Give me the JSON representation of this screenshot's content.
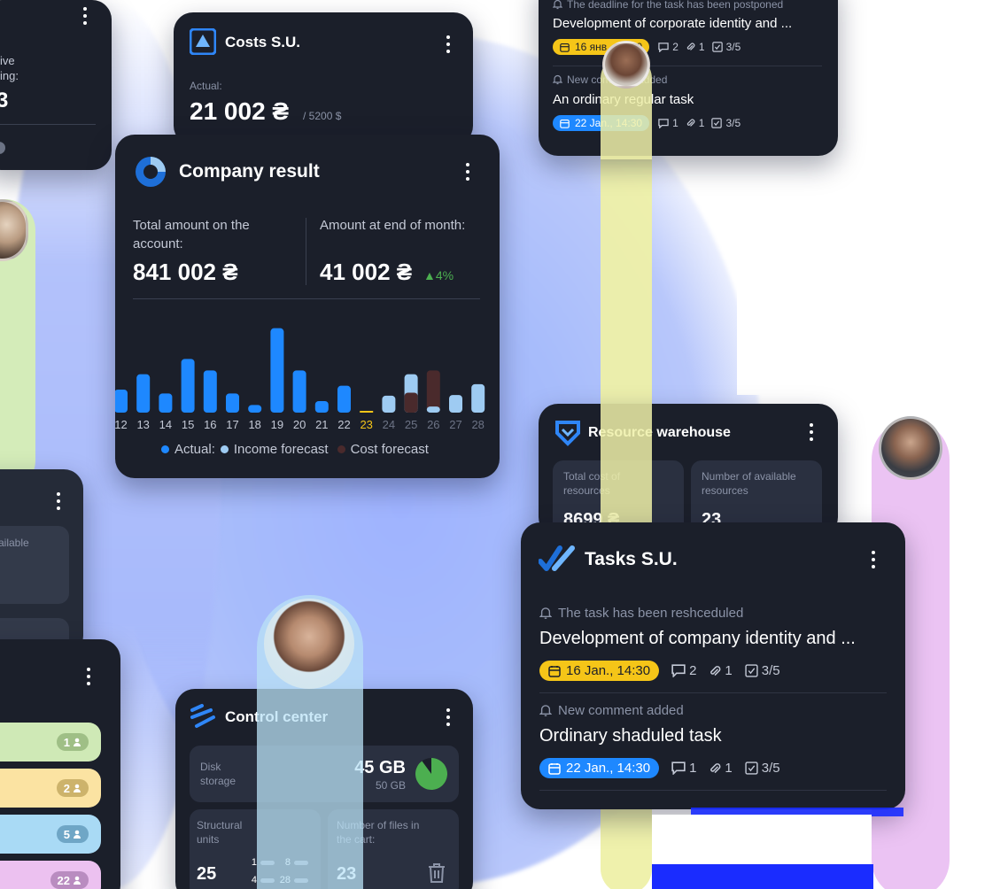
{
  "colors": {
    "accent_blue": "#1e88ff",
    "forecast_blue": "#9ecbf2",
    "cost_brown": "#4a2a2c",
    "highlight_yellow": "#f5c518",
    "growth_green": "#4caf50"
  },
  "costs_card": {
    "title": "Costs S.U.",
    "actual_label": "Actual:",
    "amount": "21 002 ₴",
    "limit": "/ 5200 $"
  },
  "left_top_card": {
    "text_line1": "ive",
    "text_line2": "ing:",
    "value": "3"
  },
  "company_card": {
    "title": "Company result",
    "total_label": "Total amount on the account:",
    "total_value": "841 002 ₴",
    "end_label": "Amount at end of month:",
    "end_value": "41 002 ₴",
    "growth": "▲4%",
    "legend": {
      "actual": "Actual:",
      "income": "Income forecast",
      "cost": "Cost forecast"
    }
  },
  "chart_data": {
    "type": "bar",
    "categories": [
      "12",
      "13",
      "14",
      "15",
      "16",
      "17",
      "18",
      "19",
      "20",
      "21",
      "22",
      "23",
      "24",
      "25",
      "26",
      "27",
      "28"
    ],
    "series": [
      {
        "name": "Actual",
        "values": [
          3,
          5,
          2.5,
          7,
          5.5,
          2.5,
          1,
          11,
          5.5,
          1.5,
          3.5,
          0,
          0,
          0,
          0,
          0,
          0
        ]
      },
      {
        "name": "Income forecast",
        "values": [
          0,
          0,
          0,
          0,
          0,
          0,
          0,
          0,
          0,
          0,
          0,
          0,
          2.2,
          5,
          0.8,
          2.3,
          3.7
        ]
      },
      {
        "name": "Cost forecast",
        "values": [
          0,
          0,
          0,
          0,
          0,
          0,
          0,
          0,
          0,
          0,
          0,
          0,
          0,
          2.6,
          5.5,
          0,
          0
        ]
      }
    ],
    "highlight_category": "23",
    "ylim": [
      0,
      12
    ],
    "legend_position": "bottom"
  },
  "top_tasks_card": {
    "row1_notice": "The deadline for the task has been postponed",
    "row1_title": "Development of corporate identity and ...",
    "row1_date": "16 янв., 14:30",
    "row1_comments": "2",
    "row1_attachments": "1",
    "row1_checklist": "3/5",
    "row2_notice": "New comment added",
    "row2_title": "An ordinary regular task",
    "row2_date": "22 Jan., 14:30",
    "row2_comments": "1",
    "row2_attachments": "1",
    "row2_checklist": "3/5"
  },
  "resource_card": {
    "title": "Resource warehouse",
    "tile1_label": "Total cost of resources",
    "tile1_value": "8699 ₴",
    "tile2_label": "Number of available resources",
    "tile2_value": "23"
  },
  "tasks_card": {
    "title": "Tasks S.U.",
    "row1_notice": "The task has been reshceduled",
    "row1_title": "Development of company identity and ...",
    "row1_date": "16 Jan., 14:30",
    "row1_comments": "2",
    "row1_attachments": "1",
    "row1_checklist": "3/5",
    "row2_notice": "New comment added",
    "row2_title": "Ordinary shaduled task",
    "row2_date": "22 Jan., 14:30",
    "row2_comments": "1",
    "row2_attachments": "1",
    "row2_checklist": "3/5"
  },
  "control_card": {
    "title": "Control center",
    "disk_label": "Disk storage",
    "disk_used": "45 GB",
    "disk_total": "50 GB",
    "disk_fraction": 0.9,
    "units_label": "Structural units",
    "units_value": "25",
    "units_small": [
      "1",
      "8",
      "4",
      "28"
    ],
    "files_label": "Number of files in the cart:",
    "files_value": "23"
  },
  "left_mid_card": {
    "tile_text": "ailable"
  },
  "left_list_card": {
    "items": [
      {
        "count": "1",
        "color": "#cfe9b6",
        "badge": "#9fbf86"
      },
      {
        "count": "2",
        "color": "#fbe3a2",
        "badge": "#cdb36b"
      },
      {
        "count": "5",
        "color": "#a9daf5",
        "badge": "#6fa6c6"
      },
      {
        "count": "22",
        "color": "#ecc1f0",
        "badge": "#b98cc0"
      }
    ]
  }
}
